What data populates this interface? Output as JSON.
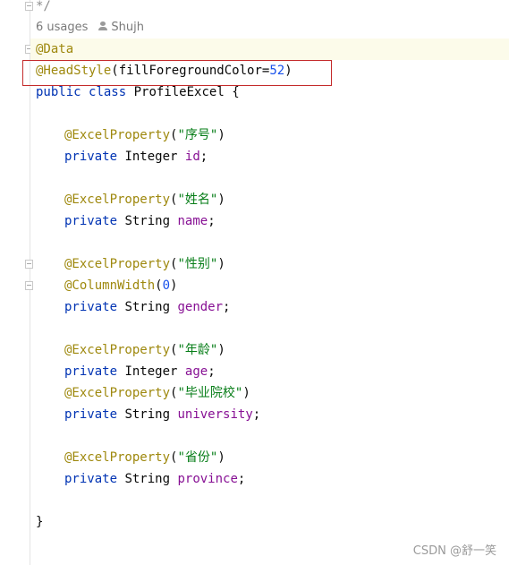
{
  "editor": {
    "comment_end": "*/",
    "usages": "6 usages",
    "author": "Shujh",
    "line_data": "@Data",
    "line_headstyle": {
      "annotation": "@HeadStyle",
      "open": "(",
      "param": "fillForegroundColor",
      "eq": "=",
      "value": "52",
      "close": ")"
    },
    "class_decl": {
      "kw_public": "public",
      "kw_class": "class",
      "name": "ProfileExcel",
      "brace": "{"
    },
    "fields": [
      {
        "annotations": [
          {
            "name": "@ExcelProperty",
            "arg": "\"序号\""
          }
        ],
        "type": "Integer",
        "name": "id"
      },
      {
        "annotations": [
          {
            "name": "@ExcelProperty",
            "arg": "\"姓名\""
          }
        ],
        "type": "String",
        "name": "name"
      },
      {
        "annotations": [
          {
            "name": "@ExcelProperty",
            "arg": "\"性别\""
          },
          {
            "name": "@ColumnWidth",
            "arg": "0"
          }
        ],
        "type": "String",
        "name": "gender"
      },
      {
        "annotations": [
          {
            "name": "@ExcelProperty",
            "arg": "\"年龄\""
          }
        ],
        "type": "Integer",
        "name": "age"
      },
      {
        "annotations": [
          {
            "name": "@ExcelProperty",
            "arg": "\"毕业院校\""
          }
        ],
        "type": "String",
        "name": "university"
      },
      {
        "annotations": [
          {
            "name": "@ExcelProperty",
            "arg": "\"省份\""
          }
        ],
        "type": "String",
        "name": "province"
      }
    ],
    "kw_private": "private",
    "semicolon": ";",
    "close_brace": "}"
  },
  "watermark": "CSDN @舒一笑",
  "colors": {
    "keyword": "#0033b3",
    "annotation": "#9e880d",
    "string": "#067d17",
    "number": "#1750eb",
    "field": "#871094",
    "highlight_box": "#c42b2b"
  }
}
